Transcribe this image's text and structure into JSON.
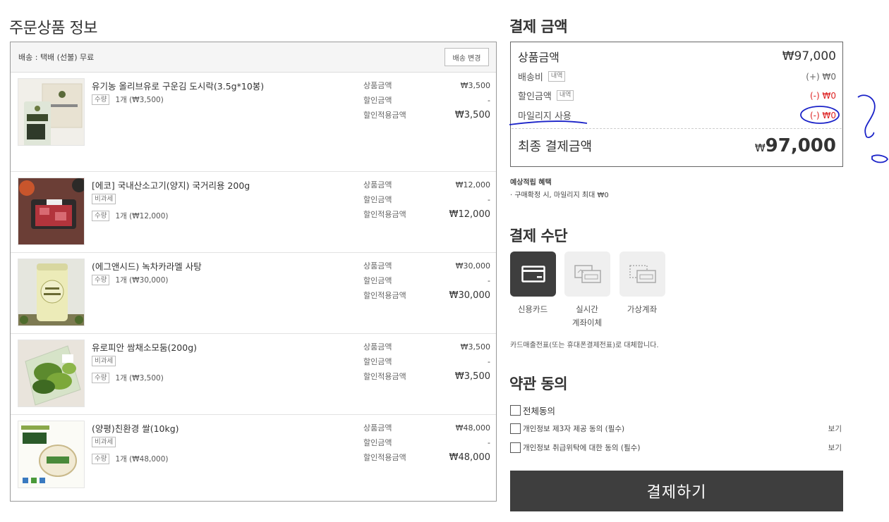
{
  "order_section": {
    "title": "주문상품 정보",
    "shipping_text": "배송 : 택배 (선불) 무료",
    "shipping_change_label": "배송 변경",
    "price_labels": {
      "product": "상품금액",
      "discount": "할인금액",
      "discounted": "할인적용금액"
    },
    "items": [
      {
        "name": "유기농 올리브유로 구운김 도시락(3.5g*10봉)",
        "tax_free": "",
        "qty_label": "수량",
        "qty_text": "1개 (₩3,500)",
        "product_price": "₩3,500",
        "discount": "-",
        "final_price": "₩3,500"
      },
      {
        "name": "[에코] 국내산소고기(양지) 국거리용 200g",
        "tax_free": "비과세",
        "qty_label": "수량",
        "qty_text": "1개 (₩12,000)",
        "product_price": "₩12,000",
        "discount": "-",
        "final_price": "₩12,000"
      },
      {
        "name": "(에그앤시드) 녹차카라멜 사탕",
        "tax_free": "",
        "qty_label": "수량",
        "qty_text": "1개 (₩30,000)",
        "product_price": "₩30,000",
        "discount": "-",
        "final_price": "₩30,000"
      },
      {
        "name": "유로피안 쌈채소모둠(200g)",
        "tax_free": "비과세",
        "qty_label": "수량",
        "qty_text": "1개 (₩3,500)",
        "product_price": "₩3,500",
        "discount": "-",
        "final_price": "₩3,500"
      },
      {
        "name": "(양평)친환경 쌀(10kg)",
        "tax_free": "비과세",
        "qty_label": "수량",
        "qty_text": "1개 (₩48,000)",
        "product_price": "₩48,000",
        "discount": "-",
        "final_price": "₩48,000"
      }
    ]
  },
  "payment_amount": {
    "title": "결제 금액",
    "product_label": "상품금액",
    "product_value": "₩97,000",
    "shipping_label": "배송비",
    "shipping_detail": "내역",
    "shipping_value": "(+) ₩0",
    "discount_label": "할인금액",
    "discount_detail": "내역",
    "discount_value": "(-) ₩0",
    "mileage_label": "마일리지 사용",
    "mileage_value": "(-) ₩0",
    "final_label": "최종 결제금액",
    "final_currency": "₩",
    "final_value": "97,000"
  },
  "benefit": {
    "title": "예상적립 혜택",
    "line": "· 구매확정 시, 마일리지 최대 ₩0"
  },
  "payment_method": {
    "title": "결제 수단",
    "methods": [
      {
        "label": "신용카드",
        "icon": "credit-card-icon",
        "selected": true
      },
      {
        "label_1": "실시간",
        "label_2": "계좌이체",
        "icon": "bank-transfer-icon",
        "selected": false
      },
      {
        "label": "가상계좌",
        "icon": "virtual-account-icon",
        "selected": false
      }
    ],
    "note": "카드매출전표(또는 휴대폰결제전표)로 대체합니다."
  },
  "terms": {
    "title": "약관 동의",
    "all_label": "전체동의",
    "items": [
      {
        "label": "개인정보 제3자 제공 동의 (필수)",
        "view": "보기"
      },
      {
        "label": "개인정보 취급위탁에 대한 동의 (필수)",
        "view": "보기"
      }
    ]
  },
  "pay_button": "결제하기",
  "colors": {
    "accent_dark": "#3e3e3e",
    "discount_red": "#dd2222",
    "annotation_blue": "#1a22c8"
  }
}
